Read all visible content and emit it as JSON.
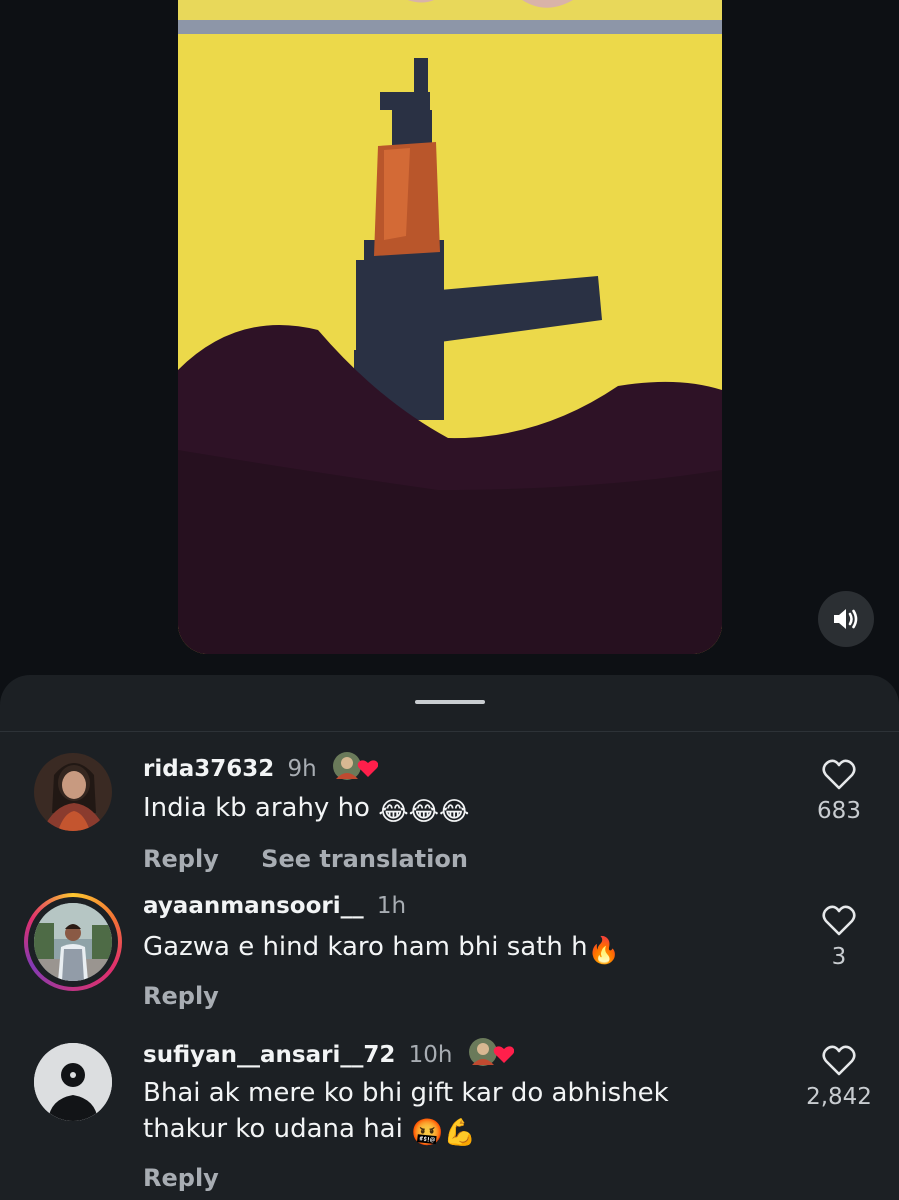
{
  "video": {
    "sound_icon": "speaker-on-icon"
  },
  "comments": [
    {
      "username": "rida37632",
      "time": "9h",
      "badge_icon": "creator-liked-heart-badge",
      "text": "India kb arahy ho",
      "emojis": [
        "😂",
        "😂",
        "😂"
      ],
      "reply_label": "Reply",
      "translate_label": "See translation",
      "likes": "683"
    },
    {
      "username": "ayaanmansoori__",
      "time": "1h",
      "text": "Gazwa e hind karo ham bhi sath h",
      "emojis": [
        "🔥"
      ],
      "reply_label": "Reply",
      "likes": "3",
      "has_story_ring": true
    },
    {
      "username": "sufiyan__ansari__72",
      "time": "10h",
      "badge_icon": "creator-liked-heart-badge",
      "text_line1": "Bhai ak mere ko bhi gift kar do abhishek",
      "text_line2": "thakur ko udana hai",
      "emojis": [
        "🤬",
        "💪"
      ],
      "reply_label": "Reply",
      "likes": "2,842"
    }
  ],
  "colors": {
    "background": "#0c0f13",
    "sheet": "#1c2024",
    "secondary_text": "#a8adb3",
    "heart_badge": "#ff1f4b"
  }
}
